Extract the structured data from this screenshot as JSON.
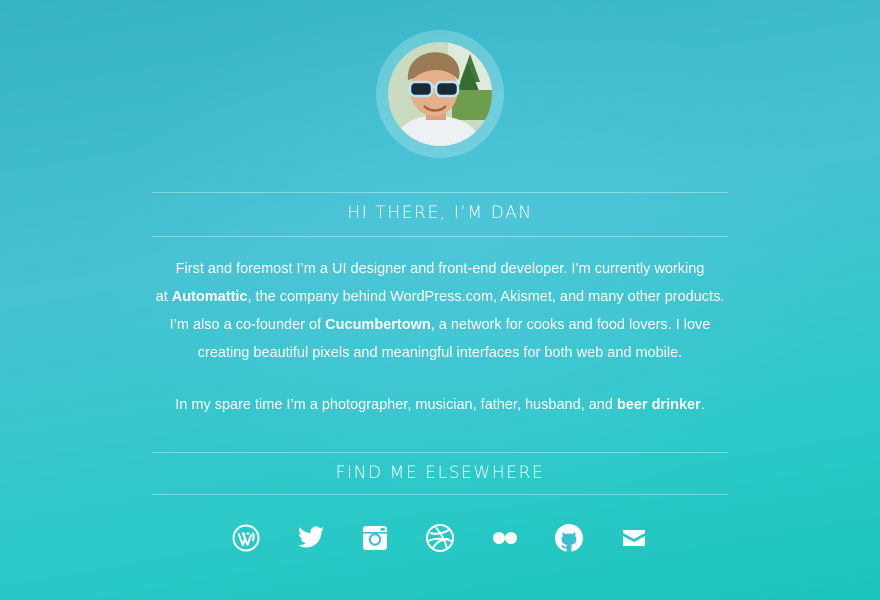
{
  "about": {
    "title": "HI THERE, I’M DAN",
    "para1": {
      "l1": "First and foremost I’m a UI designer and front-end developer. I’m currently working",
      "l2_pre": "at ",
      "l2_link": "Automattic",
      "l2_post": ", the company behind WordPress.com, Akismet, and many other products.",
      "l3_pre": "I’m also a co-founder of ",
      "l3_link": "Cucumbertown",
      "l3_post": ", a network for cooks and food lovers. I love",
      "l4": "creating beautiful pixels and meaningful interfaces for both web and mobile."
    },
    "para2": {
      "pre": "In my spare time I’m a photographer, musician, father, husband, and ",
      "link": "beer drinker",
      "post": "."
    }
  },
  "elsewhere": {
    "title": "FIND ME ELSEWHERE",
    "icons": [
      "wordpress-icon",
      "twitter-icon",
      "instagram-icon",
      "dribbble-icon",
      "flickr-icon",
      "github-icon",
      "email-icon"
    ]
  },
  "colors": {
    "background_top": "#36b3c4",
    "background_bottom": "#1cc4bb",
    "text": "#ffffff"
  }
}
